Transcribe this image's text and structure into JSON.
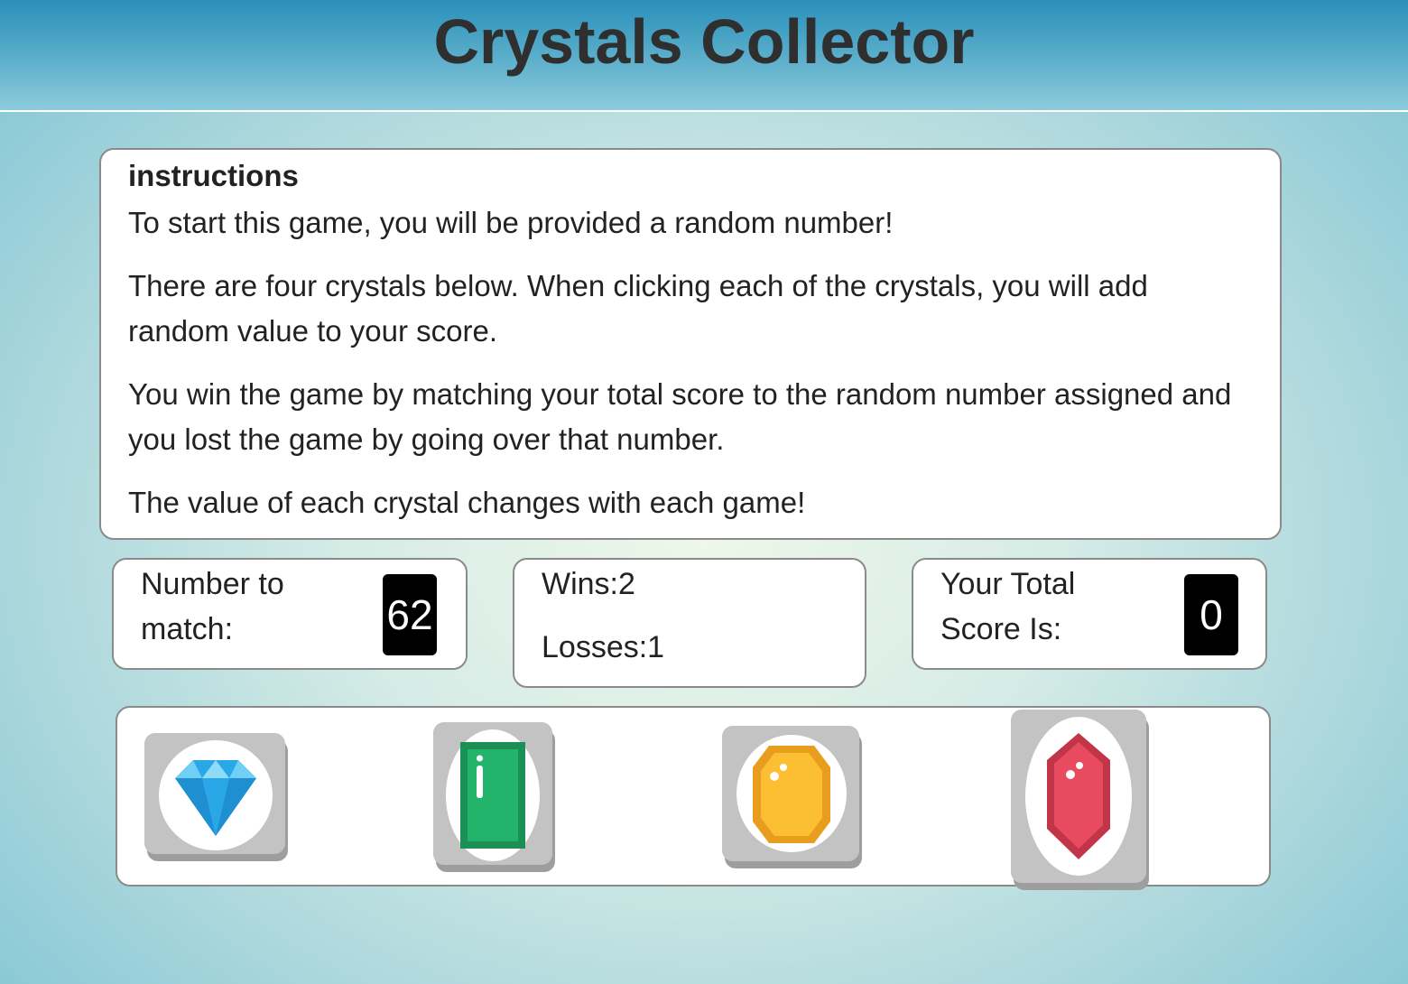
{
  "header": {
    "title": "Crystals Collector"
  },
  "instructions": {
    "heading": "instructions",
    "paragraphs": [
      "To start this game, you will be provided a random number!",
      "There are four crystals below. When clicking each of the crystals, you will add random value to your score.",
      "You win the game by matching your total score to the random number assigned and you lost the game by going over that number.",
      "The value of each crystal changes with each game!"
    ]
  },
  "scoreboard": {
    "target_label": "Number to match:",
    "target_value": "62",
    "wins_text": "Wins:2",
    "losses_text": "Losses:1",
    "total_label": "Your Total Score Is:",
    "total_value": "0"
  },
  "crystals": [
    {
      "icon": "blue-diamond-icon",
      "color": "#2aa7e6"
    },
    {
      "icon": "green-emerald-icon",
      "color": "#1fa864"
    },
    {
      "icon": "yellow-topaz-icon",
      "color": "#f7b733"
    },
    {
      "icon": "red-ruby-icon",
      "color": "#e2455a"
    }
  ]
}
